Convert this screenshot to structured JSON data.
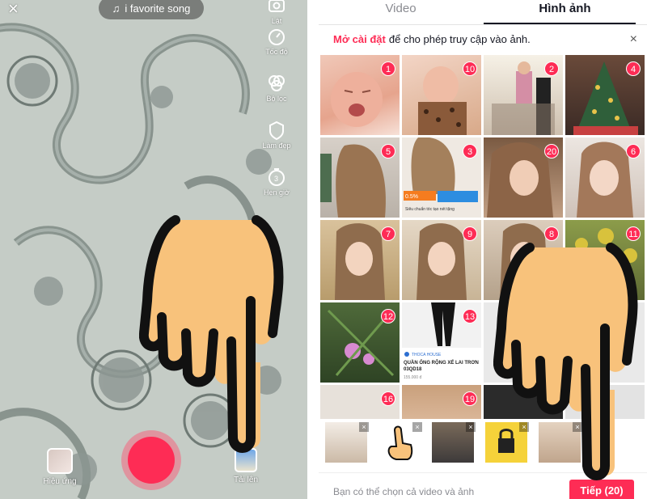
{
  "camera": {
    "sound_label": "i favorite song",
    "tools": [
      {
        "label": "Lật",
        "icon": "flip-camera-icon"
      },
      {
        "label": "Tốc độ",
        "icon": "speed-icon"
      },
      {
        "label": "Bộ lọc",
        "icon": "filter-icon"
      },
      {
        "label": "Làm đẹp",
        "icon": "beauty-icon"
      },
      {
        "label": "Hẹn giờ",
        "icon": "timer-icon"
      }
    ],
    "effects_label": "Hiệu ứng",
    "upload_label": "Tải lên",
    "close_icon": "×"
  },
  "gallery": {
    "tabs": [
      {
        "label": "Video",
        "active": false
      },
      {
        "label": "Hình ảnh",
        "active": true
      }
    ],
    "notice": {
      "link": "Mở cài đặt",
      "text": "để cho phép truy cập vào ảnh.",
      "close": "×"
    },
    "grid_badges": [
      "1",
      "10",
      "2",
      "4",
      "5",
      "3",
      "20",
      "6",
      "7",
      "9",
      "8",
      "11",
      "12",
      "13",
      "",
      "",
      "16",
      "19",
      "",
      ""
    ],
    "promo_text": "QUẦN ỐNG RỘNG XẾ LAI TRƠN",
    "promo_code": "03QD18",
    "promo_brand": "THOCA HOUSE",
    "promo_price": "155.000 đ",
    "promo_badge": "0.5%",
    "promo_caption": "Siêu chuẩn tóc tạo nét tặng",
    "strip_close": "×",
    "footer_text": "Bạn có thể chọn cả video và ảnh",
    "next_button": "Tiếp (20)"
  },
  "colors": {
    "accent": "#fe2c55",
    "text_primary": "#161823",
    "text_secondary": "#8a8b91",
    "hand_fill": "#f8c27b"
  }
}
